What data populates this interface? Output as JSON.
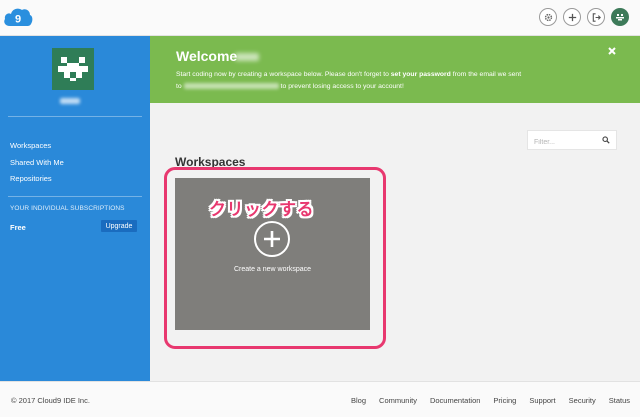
{
  "colors": {
    "sidebar": "#2a89d9",
    "banner": "#7bba4f",
    "card": "#7f7e7b",
    "highlight": "#e8386f",
    "upgrade_button": "#1a6cbf"
  },
  "header": {
    "logo_text": "9",
    "icons": [
      "gear-icon",
      "plus-icon",
      "sign-out-icon",
      "avatar-icon"
    ]
  },
  "sidebar": {
    "nav": [
      "Workspaces",
      "Shared With Me",
      "Repositories"
    ],
    "subscriptions_heading": "YOUR INDIVIDUAL SUBSCRIPTIONS",
    "plan": "Free",
    "upgrade_label": "Upgrade"
  },
  "banner": {
    "title": "Welcome",
    "line1_pre": "Start coding now by creating a workspace below. Please don't forget to ",
    "line1_bold": "set your password",
    "line1_post": " from the email we sent",
    "line2_pre": "to",
    "line2_post": "to prevent losing access to your account!"
  },
  "filter": {
    "placeholder": "Filter..."
  },
  "workspaces": {
    "title": "Workspaces",
    "create_label": "Create a new workspace"
  },
  "annotation": {
    "text": "クリックする"
  },
  "footer": {
    "copyright": "© 2017 Cloud9 IDE Inc.",
    "links": [
      "Blog",
      "Community",
      "Documentation",
      "Pricing",
      "Support",
      "Security",
      "Status"
    ]
  }
}
